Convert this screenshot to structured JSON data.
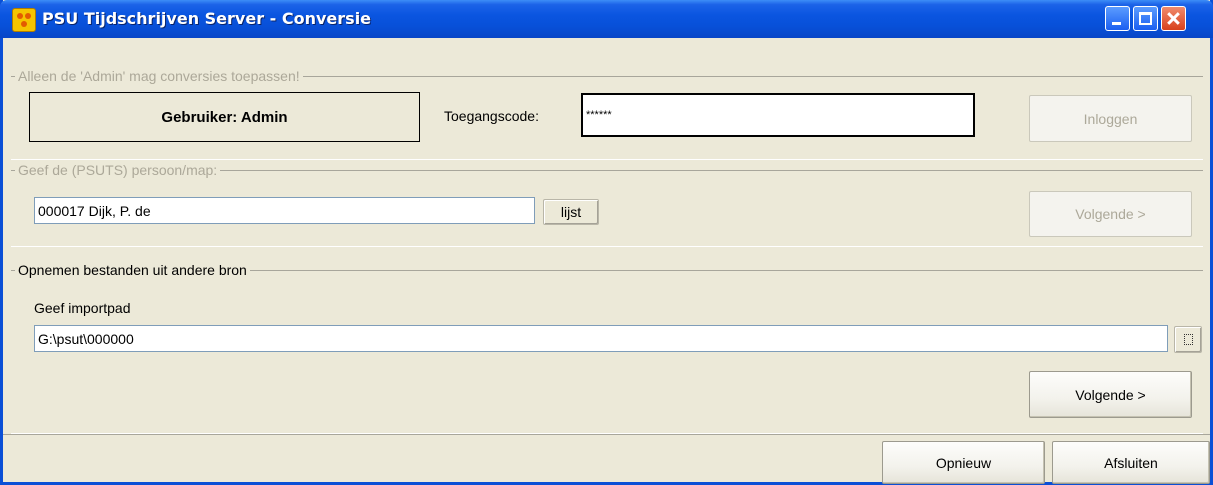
{
  "window": {
    "title": "PSU Tijdschrijven Server - Conversie",
    "icons": {
      "app": "app-logo-icon",
      "minimize": "minimize-icon",
      "maximize": "maximize-icon",
      "close": "close-icon"
    }
  },
  "login_group": {
    "legend": "Alleen de 'Admin' mag conversies toepassen!",
    "user_label": "Gebruiker: Admin",
    "access_code_label": "Toegangscode:",
    "access_code_value": "******",
    "login_button": "Inloggen"
  },
  "person_group": {
    "legend": "Geef de (PSUTS) persoon/map:",
    "person_value": "000017 Dijk, P. de",
    "list_button": "lijst",
    "next_button": "Volgende >"
  },
  "import_group": {
    "legend": "Opnemen bestanden uit andere bron",
    "path_label": "Geef importpad",
    "path_value": "G:\\psut\\000000",
    "browse_icon": "browse-folder-icon",
    "next_button": "Volgende >"
  },
  "footer": {
    "reset_button": "Opnieuw",
    "close_button": "Afsluiten"
  },
  "colors": {
    "titlebar": "#0a55e0",
    "window_bg": "#ece9d8",
    "disabled_text": "#aca899"
  }
}
